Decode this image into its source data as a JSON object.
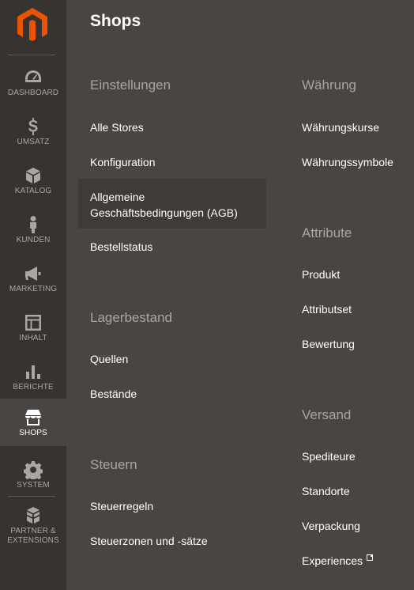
{
  "nav": {
    "items": [
      {
        "label": "DASHBOARD",
        "icon": "gauge-icon"
      },
      {
        "label": "UMSATZ",
        "icon": "dollar-icon"
      },
      {
        "label": "KATALOG",
        "icon": "cube-icon"
      },
      {
        "label": "KUNDEN",
        "icon": "person-icon"
      },
      {
        "label": "MARKETING",
        "icon": "megaphone-icon"
      },
      {
        "label": "INHALT",
        "icon": "layout-icon"
      },
      {
        "label": "BERICHTE",
        "icon": "bar-chart-icon"
      },
      {
        "label": "SHOPS",
        "icon": "store-icon",
        "active": true
      },
      {
        "label": "SYSTEM",
        "icon": "gear-icon"
      },
      {
        "label": "PARTNER &",
        "label2": "EXTENSIONS",
        "icon": "blocks-icon"
      }
    ]
  },
  "page": {
    "title": "Shops"
  },
  "sections": {
    "einstellungen": {
      "title": "Einstellungen",
      "links": [
        "Alle Stores",
        "Konfiguration",
        "Allgemeine",
        "Geschäftsbedingungen (AGB)",
        "Bestellstatus"
      ]
    },
    "lagerbestand": {
      "title": "Lagerbestand",
      "links": [
        "Quellen",
        "Bestände"
      ]
    },
    "steuern": {
      "title": "Steuern",
      "links": [
        "Steuerregeln",
        "Steuerzonen und -sätze"
      ]
    },
    "waehrung": {
      "title": "Währung",
      "links": [
        "Währungskurse",
        "Währungssymbole"
      ]
    },
    "attribute": {
      "title": "Attribute",
      "links": [
        "Produkt",
        "Attributset",
        "Bewertung"
      ]
    },
    "versand": {
      "title": "Versand",
      "links": [
        "Spediteure",
        "Standorte",
        "Verpackung",
        "Experiences"
      ]
    }
  },
  "colors": {
    "logo": "#eb5202",
    "nav_bg": "#373330",
    "panel_bg": "#4a4542"
  }
}
